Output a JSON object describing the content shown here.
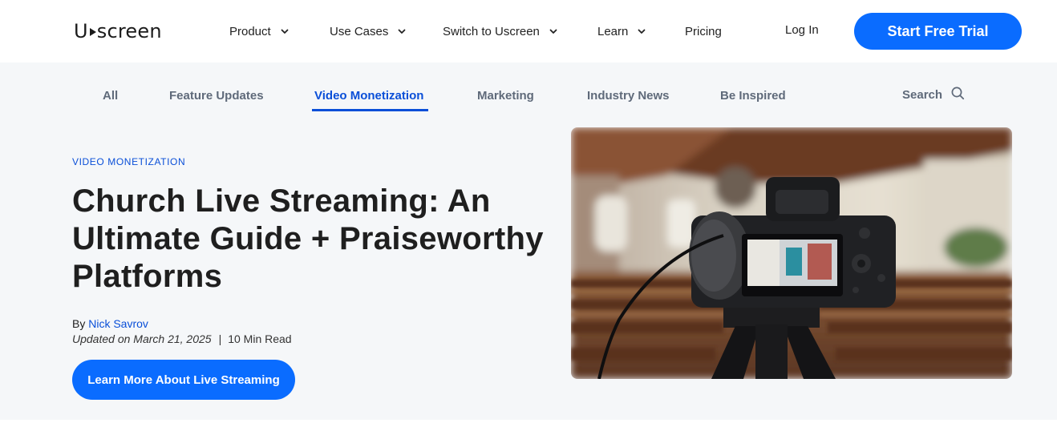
{
  "brand": {
    "logo_left": "U",
    "logo_right": "screen"
  },
  "nav": {
    "items": [
      {
        "label": "Product",
        "dropdown": true
      },
      {
        "label": "Use Cases",
        "dropdown": true
      },
      {
        "label": "Switch to Uscreen",
        "dropdown": true
      },
      {
        "label": "Learn",
        "dropdown": true
      },
      {
        "label": "Pricing",
        "dropdown": false
      }
    ],
    "login": "Log In",
    "cta": "Start Free Trial"
  },
  "blog_tabs": {
    "items": [
      "All",
      "Feature Updates",
      "Video Monetization",
      "Marketing",
      "Industry News",
      "Be Inspired"
    ],
    "active": "Video Monetization",
    "search_label": "Search"
  },
  "article": {
    "category": "VIDEO MONETIZATION",
    "title": "Church Live Streaming: An Ultimate Guide + Praiseworthy Platforms",
    "by": "By",
    "author": "Nick Savrov",
    "updated": "Updated on March 21, 2025",
    "separator": "|",
    "read_time": "10 Min Read",
    "cta": "Learn More About Live Streaming"
  },
  "hero_image": {
    "subject": "camera-on-tripod-in-church"
  },
  "colors": {
    "accent": "#0a6cff",
    "link": "#0a4fd8",
    "hero_bg": "#f5f7f9",
    "tab_text": "#5f6a7a"
  }
}
